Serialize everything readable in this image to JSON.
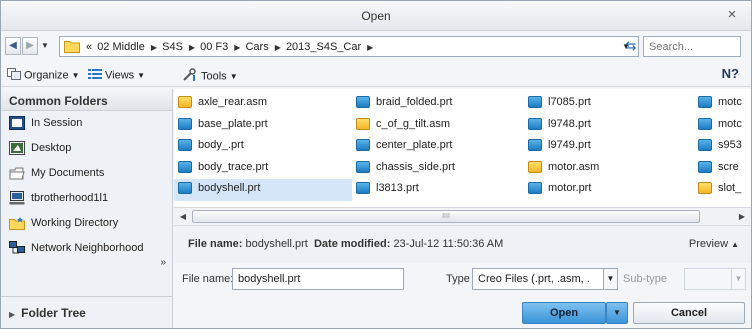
{
  "window": {
    "title": "Open",
    "close_glyph": "×"
  },
  "nav": {
    "back_icon": "back-arrow-icon",
    "forward_icon": "forward-arrow-icon",
    "crumbs_prefix": "«",
    "crumbs": [
      "02 Middle",
      "S4S",
      "00 F3",
      "Cars",
      "2013_S4S_Car"
    ],
    "search_placeholder": "Search..."
  },
  "toolbar": {
    "organize": "Organize",
    "views": "Views",
    "tools": "Tools"
  },
  "sidebar": {
    "header": "Common Folders",
    "items": [
      {
        "label": "In Session",
        "icon": "session-icon"
      },
      {
        "label": "Desktop",
        "icon": "desktop-icon"
      },
      {
        "label": "My Documents",
        "icon": "documents-icon"
      },
      {
        "label": "tbrotherhood1l1",
        "icon": "computer-icon"
      },
      {
        "label": "Working Directory",
        "icon": "working-directory-icon"
      },
      {
        "label": "Network Neighborhood",
        "icon": "network-icon"
      }
    ],
    "folder_tree": "Folder Tree"
  },
  "files": {
    "columns": [
      [
        {
          "name": "axle_rear.asm",
          "type": "asm"
        },
        {
          "name": "base_plate.prt",
          "type": "prt"
        },
        {
          "name": "body_.prt",
          "type": "prt"
        },
        {
          "name": "body_trace.prt",
          "type": "prt"
        },
        {
          "name": "bodyshell.prt",
          "type": "prt",
          "selected": true
        }
      ],
      [
        {
          "name": "braid_folded.prt",
          "type": "prt"
        },
        {
          "name": "c_of_g_tilt.asm",
          "type": "asm"
        },
        {
          "name": "center_plate.prt",
          "type": "prt"
        },
        {
          "name": "chassis_side.prt",
          "type": "prt"
        },
        {
          "name": "l3813.prt",
          "type": "prt"
        }
      ],
      [
        {
          "name": "l7085.prt",
          "type": "prt"
        },
        {
          "name": "l9748.prt",
          "type": "prt"
        },
        {
          "name": "l9749.prt",
          "type": "prt"
        },
        {
          "name": "motor.asm",
          "type": "asm"
        },
        {
          "name": "motor.prt",
          "type": "prt"
        }
      ],
      [
        {
          "name": "motc",
          "type": "prt"
        },
        {
          "name": "motc",
          "type": "prt"
        },
        {
          "name": "s953",
          "type": "prt"
        },
        {
          "name": "scre",
          "type": "prt"
        },
        {
          "name": "slot_",
          "type": "asm"
        }
      ]
    ]
  },
  "scrollbar": {
    "thumb_grip": "IIII"
  },
  "details": {
    "file_name_label": "File name:",
    "file_name_value": "bodyshell.prt",
    "modified_label": "Date modified:",
    "modified_value": "23-Jul-12 11:50:36 AM",
    "preview_label": "Preview"
  },
  "form": {
    "file_name_label": "File name:",
    "file_name_value": "bodyshell.prt",
    "type_label": "Type",
    "type_value": "Creo Files (.prt, .asm, .",
    "subtype_label": "Sub-type"
  },
  "buttons": {
    "open": "Open",
    "cancel": "Cancel"
  },
  "colors": {
    "selection": "#d4e6f7",
    "open_button": "#3a93d6",
    "prt_icon": "#1d7cc2",
    "asm_icon": "#f2b628"
  }
}
